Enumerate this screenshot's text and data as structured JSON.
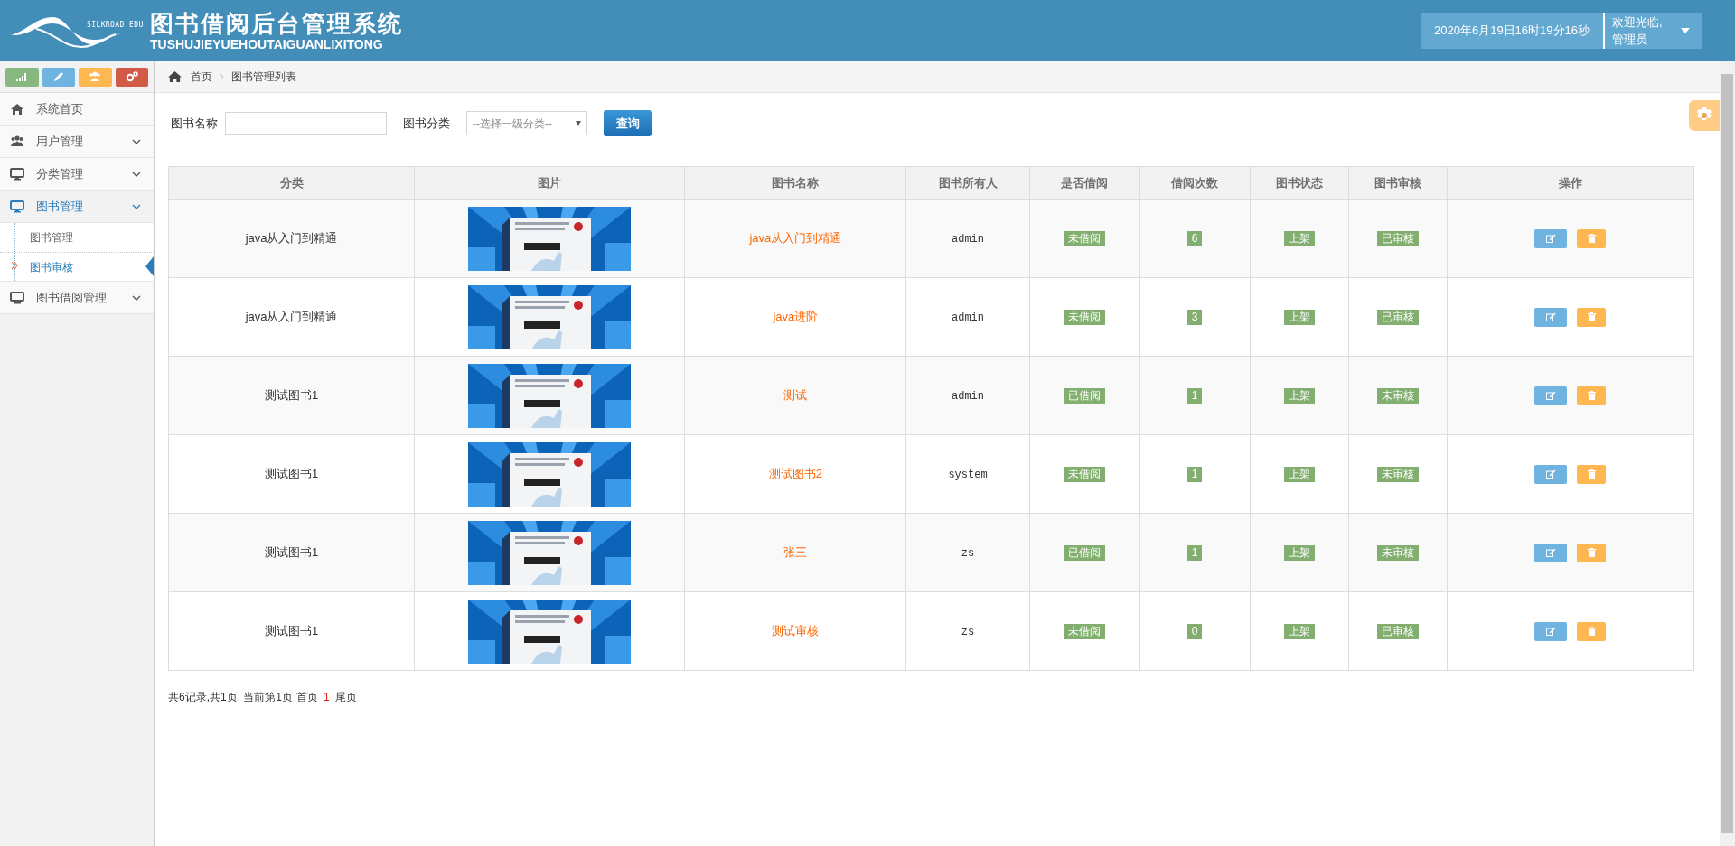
{
  "header": {
    "logo_text": "SILKROAD EDU",
    "title": "图书借阅后台管理系统",
    "subtitle": "TUSHUJIEYUEHOUTAIGUANLIXITONG",
    "datetime": "2020年6月19日16时19分16秒",
    "welcome": "欢迎光临,",
    "user": "管理员"
  },
  "sidebar": {
    "items": [
      {
        "label": "系统首页",
        "selected": false
      },
      {
        "label": "用户管理",
        "selected": false
      },
      {
        "label": "分类管理",
        "selected": false
      },
      {
        "label": "图书管理",
        "selected": true,
        "children": [
          {
            "label": "图书管理",
            "selected": false
          },
          {
            "label": "图书审核",
            "selected": true
          }
        ]
      },
      {
        "label": "图书借阅管理",
        "selected": false
      }
    ]
  },
  "breadcrumb": [
    "首页",
    "图书管理列表"
  ],
  "search": {
    "name_label": "图书名称",
    "category_label": "图书分类",
    "category_placeholder": "--选择一级分类--",
    "button": "查询"
  },
  "table": {
    "columns": [
      "分类",
      "图片",
      "图书名称",
      "图书所有人",
      "是否借阅",
      "借阅次数",
      "图书状态",
      "图书审核",
      "操作"
    ],
    "rows": [
      {
        "category": "java从入门到精通",
        "name": "java从入门到精通",
        "owner": "admin",
        "borrowed": "未借阅",
        "count": "6",
        "status": "上架",
        "audit": "已审核"
      },
      {
        "category": "java从入门到精通",
        "name": "java进阶",
        "owner": "admin",
        "borrowed": "未借阅",
        "count": "3",
        "status": "上架",
        "audit": "已审核"
      },
      {
        "category": "测试图书1",
        "name": "测试",
        "owner": "admin",
        "borrowed": "已借阅",
        "count": "1",
        "status": "上架",
        "audit": "未审核"
      },
      {
        "category": "测试图书1",
        "name": "测试图书2",
        "owner": "system",
        "borrowed": "未借阅",
        "count": "1",
        "status": "上架",
        "audit": "未审核"
      },
      {
        "category": "测试图书1",
        "name": "张三",
        "owner": "zs",
        "borrowed": "已借阅",
        "count": "1",
        "status": "上架",
        "audit": "未审核"
      },
      {
        "category": "测试图书1",
        "name": "测试审核",
        "owner": "zs",
        "borrowed": "未借阅",
        "count": "0",
        "status": "上架",
        "audit": "已审核"
      }
    ]
  },
  "pagination": {
    "summary": "共6记录,共1页, 当前第1页",
    "first": "首页",
    "current": "1",
    "last": "尾页"
  }
}
